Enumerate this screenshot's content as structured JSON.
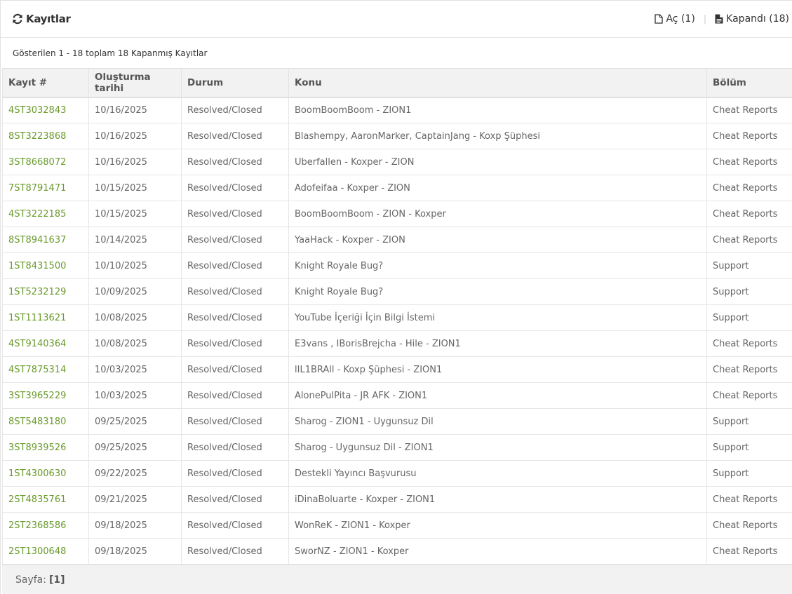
{
  "header": {
    "title": "Kayıtlar",
    "open_label": "Aç (1)",
    "closed_label": "Kapandı (18)"
  },
  "summary": "Gösterilen 1 - 18 toplam 18 Kapanmış Kayıtlar",
  "table": {
    "columns": [
      "Kayıt #",
      "Oluşturma tarihi",
      "Durum",
      "Konu",
      "Bölüm"
    ],
    "rows": [
      [
        "4ST3032843",
        "10/16/2025",
        "Resolved/Closed",
        "BoomBoomBoom - ZION1",
        "Cheat Reports"
      ],
      [
        "8ST3223868",
        "10/16/2025",
        "Resolved/Closed",
        "Blashempy, AaronMarker, CaptainJang - Koxp Şüphesi",
        "Cheat Reports"
      ],
      [
        "3ST8668072",
        "10/16/2025",
        "Resolved/Closed",
        "Uberfallen - Koxper - ZION",
        "Cheat Reports"
      ],
      [
        "7ST8791471",
        "10/15/2025",
        "Resolved/Closed",
        "Adofeifaa - Koxper - ZION",
        "Cheat Reports"
      ],
      [
        "4ST3222185",
        "10/15/2025",
        "Resolved/Closed",
        "BoomBoomBoom - ZION - Koxper",
        "Cheat Reports"
      ],
      [
        "8ST8941637",
        "10/14/2025",
        "Resolved/Closed",
        "YaaHack - Koxper - ZION",
        "Cheat Reports"
      ],
      [
        "1ST8431500",
        "10/10/2025",
        "Resolved/Closed",
        "Knight Royale Bug?",
        "Support"
      ],
      [
        "1ST5232129",
        "10/09/2025",
        "Resolved/Closed",
        "Knight Royale Bug?",
        "Support"
      ],
      [
        "1ST1113621",
        "10/08/2025",
        "Resolved/Closed",
        "YouTube İçeriği İçin Bilgi İstemi",
        "Support"
      ],
      [
        "4ST9140364",
        "10/08/2025",
        "Resolved/Closed",
        "E3vans , IBorisBrejcha - Hile - ZION1",
        "Cheat Reports"
      ],
      [
        "4ST7875314",
        "10/03/2025",
        "Resolved/Closed",
        "lIL1BRAll - Koxp Şüphesi - ZION1",
        "Cheat Reports"
      ],
      [
        "3ST3965229",
        "10/03/2025",
        "Resolved/Closed",
        "AlonePulPita - JR AFK - ZION1",
        "Cheat Reports"
      ],
      [
        "8ST5483180",
        "09/25/2025",
        "Resolved/Closed",
        "Sharog - ZION1 - Uygunsuz Dil",
        "Support"
      ],
      [
        "3ST8939526",
        "09/25/2025",
        "Resolved/Closed",
        "Sharog - Uygunsuz Dil - ZION1",
        "Support"
      ],
      [
        "1ST4300630",
        "09/22/2025",
        "Resolved/Closed",
        "Destekli Yayıncı Başvurusu",
        "Support"
      ],
      [
        "2ST4835761",
        "09/21/2025",
        "Resolved/Closed",
        "iDinaBoluarte - Koxper - ZION1",
        "Cheat Reports"
      ],
      [
        "2ST2368586",
        "09/18/2025",
        "Resolved/Closed",
        "WonReK - ZION1 - Koxper",
        "Cheat Reports"
      ],
      [
        "2ST1300648",
        "09/18/2025",
        "Resolved/Closed",
        "SworNZ - ZION1 - Koxper",
        "Cheat Reports"
      ]
    ]
  },
  "pagination": {
    "label": "Sayfa:",
    "current": "[1]"
  },
  "icons": {
    "title": "refresh-icon",
    "open": "file-outline-icon",
    "closed": "file-text-icon"
  },
  "colors": {
    "ticket_link": "#6a9a2c"
  }
}
